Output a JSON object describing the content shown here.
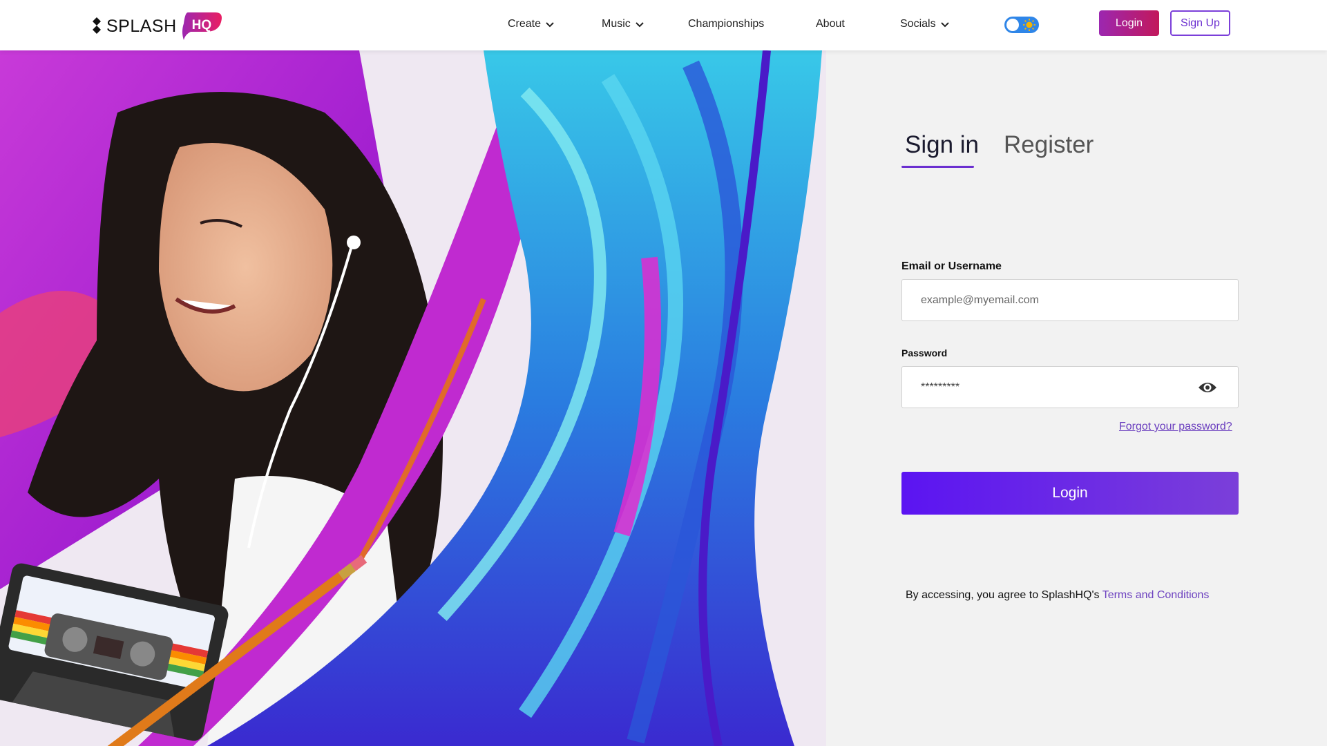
{
  "brand": {
    "name": "SPLASH",
    "badge": "HQ",
    "colors": {
      "primary": "#5b14f2",
      "accent": "#9c27b0",
      "pink": "#c2185b",
      "badge_gradient": [
        "#9c27b0",
        "#e91e63"
      ]
    }
  },
  "nav": {
    "items": [
      {
        "label": "Create",
        "has_dropdown": true
      },
      {
        "label": "Music",
        "has_dropdown": true
      },
      {
        "label": "Championships",
        "has_dropdown": false
      },
      {
        "label": "About",
        "has_dropdown": false
      },
      {
        "label": "Socials",
        "has_dropdown": true
      }
    ],
    "theme_toggle_icon": "sun-icon",
    "login_label": "Login",
    "signup_label": "Sign Up"
  },
  "auth": {
    "tabs": [
      {
        "label": "Sign in",
        "active": true
      },
      {
        "label": "Register",
        "active": false
      }
    ],
    "email": {
      "label": "Email or Username",
      "placeholder": "example@myemail.com",
      "value": ""
    },
    "password": {
      "label": "Password",
      "value": "*********",
      "toggle_icon": "eye-icon"
    },
    "forgot_label": "Forgot your password?",
    "submit_label": "Login",
    "terms_prefix": "By accessing, you agree to SplashHQ's",
    "terms_link": "Terms and Conditions"
  }
}
